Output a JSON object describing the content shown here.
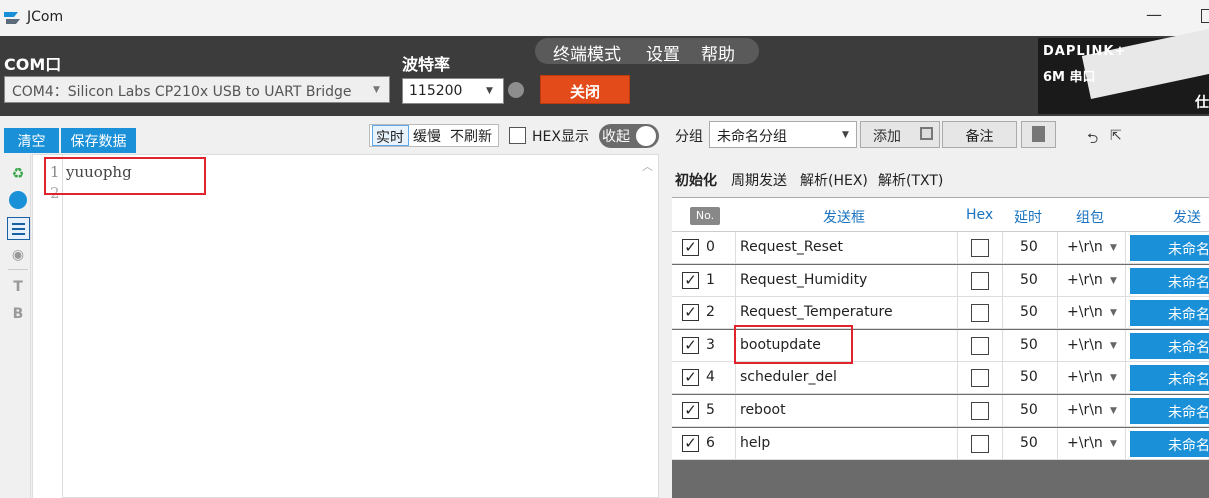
{
  "window": {
    "title": "JCom"
  },
  "toolbar": {
    "com_label": "COM口",
    "com_value": "COM4：Silicon Labs CP210x USB to UART Bridge",
    "baud_label": "波特率",
    "baud_value": "115200",
    "close_label": "关闭",
    "menu": {
      "terminal": "终端模式",
      "settings": "设置",
      "help": "帮助"
    },
    "ad": {
      "line1": "DAPLINK+",
      "line2": "6M 串口",
      "line3": "仕"
    }
  },
  "left": {
    "clear_label": "清空",
    "save_label": "保存数据",
    "mode": {
      "realtime": "实时",
      "slow": "缓慢",
      "norefresh": "不刷新"
    },
    "hex_display": "HEX显示",
    "collapse": "收起",
    "side_t": "T",
    "side_b": "B",
    "editor": {
      "line1_no": "1",
      "line2_no": "2",
      "line1_text": "yuuophg"
    }
  },
  "right": {
    "group_label": "分组",
    "group_value": "未命名分组",
    "add_label": "添加",
    "note_label": "备注",
    "tabs": [
      "初始化",
      "周期发送",
      "解析(HEX)",
      "解析(TXT)"
    ],
    "headers": {
      "no": "No.",
      "frame": "发送框",
      "hex": "Hex",
      "delay": "延时",
      "pkg": "组包",
      "send": "发送"
    },
    "rows": [
      {
        "idx": "0",
        "cmd": "Request_Reset",
        "delay": "50",
        "pkg": "+\\r\\n",
        "send": "未命名"
      },
      {
        "idx": "1",
        "cmd": "Request_Humidity",
        "delay": "50",
        "pkg": "+\\r\\n",
        "send": "未命名"
      },
      {
        "idx": "2",
        "cmd": "Request_Temperature",
        "delay": "50",
        "pkg": "+\\r\\n",
        "send": "未命名"
      },
      {
        "idx": "3",
        "cmd": "bootupdate",
        "delay": "50",
        "pkg": "+\\r\\n",
        "send": "未命名"
      },
      {
        "idx": "4",
        "cmd": "scheduler_del",
        "delay": "50",
        "pkg": "+\\r\\n",
        "send": "未命名"
      },
      {
        "idx": "5",
        "cmd": "reboot",
        "delay": "50",
        "pkg": "+\\r\\n",
        "send": "未命名"
      },
      {
        "idx": "6",
        "cmd": "help",
        "delay": "50",
        "pkg": "+\\r\\n",
        "send": "未命名"
      }
    ]
  },
  "icons": {
    "app": "app-logo-icon",
    "gear": "gear-icon",
    "recycle": "recycle-icon",
    "clock": "clock-icon",
    "list": "list-icon",
    "eye": "eye-hidden-icon",
    "add": "copy-icon",
    "trash": "trash-icon",
    "import": "import-icon",
    "export": "export-icon"
  },
  "colors": {
    "accent": "#1a90d9",
    "close": "#e34b1a",
    "toolbar": "#3c3c3c",
    "highlight": "#e0242e"
  }
}
